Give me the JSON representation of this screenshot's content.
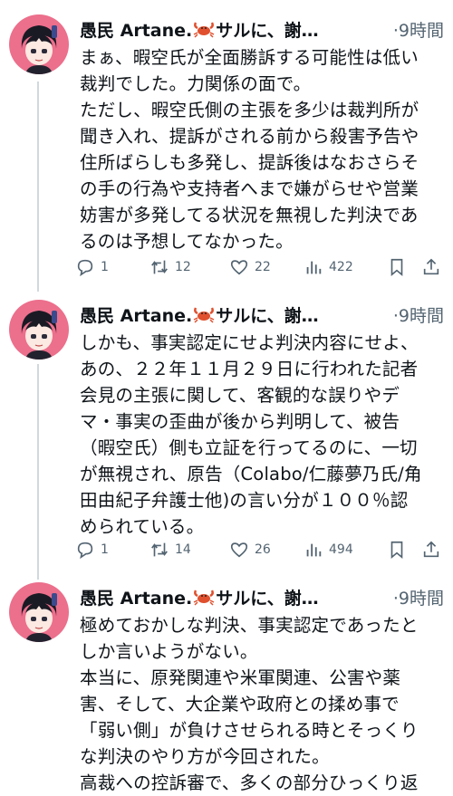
{
  "tweets": [
    {
      "author": "愚民 Artane.",
      "author_suffix": "サルに、謝…",
      "time": "·9時間",
      "lines": [
        "まぁ、暇空氏が全面勝訴する可能性は低い",
        "裁判でした。力関係の面で。",
        "ただし、暇空氏側の主張を多少は裁判所が",
        "聞き入れ、提訴がされる前から殺害予告や",
        "住所ばらしも多発し、提訴後はなおさらそ",
        "の手の行為や支持者へまで嫌がらせや営業",
        "妨害が多発してる状況を無視した判決であ",
        "るのは予想してなかった。"
      ],
      "replies": "1",
      "retweets": "12",
      "likes": "22",
      "views": "422"
    },
    {
      "author": "愚民 Artane.",
      "author_suffix": "サルに、謝…",
      "time": "·9時間",
      "lines": [
        "しかも、事実認定にせよ判決内容にせよ、",
        "あの、２２年１１月２９日に行われた記者",
        "会見の主張に関して、客観的な誤りやデ",
        "マ・事実の歪曲が後から判明して、被告",
        "（暇空氏）側も立証を行ってるのに、一切",
        "が無視され、原告（Colabo/仁藤夢乃氏/角",
        "田由紀子弁護士他)の言い分が１００％認",
        "められている。"
      ],
      "replies": "1",
      "retweets": "14",
      "likes": "26",
      "views": "494"
    },
    {
      "author": "愚民 Artane.",
      "author_suffix": "サルに、謝…",
      "time": "·9時間",
      "lines": [
        "極めておかしな判決、事実認定であったと",
        "しか言いようがない。",
        "本当に、原発関連や米軍関連、公害や薬",
        "害、そして、大企業や政府との揉め事で",
        "「弱い側」が負けさせられる時とそっくり",
        "な判決のやり方が今回された。",
        "高裁への控訴審で、多くの部分ひっくり返"
      ]
    }
  ],
  "icons": {
    "reply": "reply-icon",
    "retweet": "retweet-icon",
    "like": "heart-icon",
    "views": "views-icon",
    "bookmark": "bookmark-icon",
    "share": "share-icon",
    "crab": "crab-emoji-icon"
  },
  "colors": {
    "avatar_bg": "#ec6f8c",
    "thread_line": "#cfd9de",
    "muted": "#536471"
  }
}
